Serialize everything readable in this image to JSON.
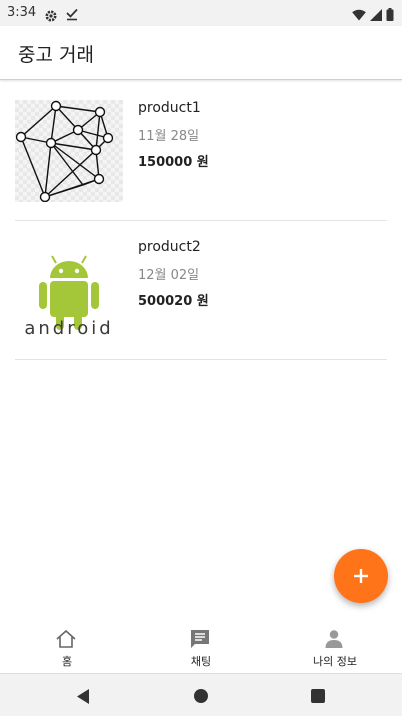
{
  "status_bar": {
    "time": "3:34",
    "icons": [
      "settings-gear-icon",
      "download-done-icon",
      "wifi-icon",
      "signal-icon",
      "battery-icon"
    ]
  },
  "app_bar": {
    "title": "중고 거래"
  },
  "products": [
    {
      "name": "product1",
      "date": "11월 28일",
      "price": "150000 원",
      "image": "network-graph-image"
    },
    {
      "name": "product2",
      "date": "12월 02일",
      "price": "500020 원",
      "image": "android-logo-image",
      "image_text": "android"
    }
  ],
  "fab": {
    "icon": "plus-icon",
    "color": "#ff7418"
  },
  "bottom_nav": [
    {
      "label": "홈",
      "icon": "home-icon"
    },
    {
      "label": "채팅",
      "icon": "chat-icon"
    },
    {
      "label": "나의 정보",
      "icon": "person-icon"
    }
  ],
  "system_nav": [
    "back-icon",
    "home-circle-icon",
    "recents-icon"
  ],
  "colors": {
    "accent": "#ff7418",
    "android_green": "#a4c639"
  }
}
